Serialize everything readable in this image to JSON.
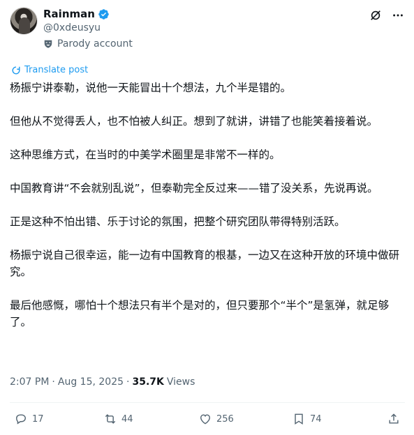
{
  "author": {
    "display_name": "Rainman",
    "handle": "@0xdeusyu",
    "label": "Parody account",
    "verified": true
  },
  "translate_label": "Translate post",
  "paragraphs": [
    "杨振宁讲泰勒，说他一天能冒出十个想法，九个半是错的。",
    "但他从不觉得丢人，也不怕被人纠正。想到了就讲，讲错了也能笑着接着说。",
    "这种思维方式，在当时的中美学术圈里是非常不一样的。",
    "中国教育讲“不会就别乱说”，但泰勒完全反过来——错了没关系，先说再说。",
    "正是这种不怕出错、乐于讨论的氛围，把整个研究团队带得特别活跃。",
    "杨振宁说自己很幸运，能一边有中国教育的根基，一边又在这种开放的环境中做研究。",
    "最后他感慨，哪怕十个想法只有半个是对的，但只要那个“半个”是氢弹，就足够了。"
  ],
  "meta": {
    "time": "2:07 PM",
    "separator1": "·",
    "date": "Aug 15, 2025",
    "separator2": "·",
    "views_count": "35.7K",
    "views_label": "Views"
  },
  "actions": {
    "reply_count": "17",
    "retweet_count": "44",
    "like_count": "256",
    "bookmark_count": "74"
  },
  "colors": {
    "accent": "#1d9bf0",
    "secondary_text": "#536471",
    "primary_text": "#0f1419"
  }
}
